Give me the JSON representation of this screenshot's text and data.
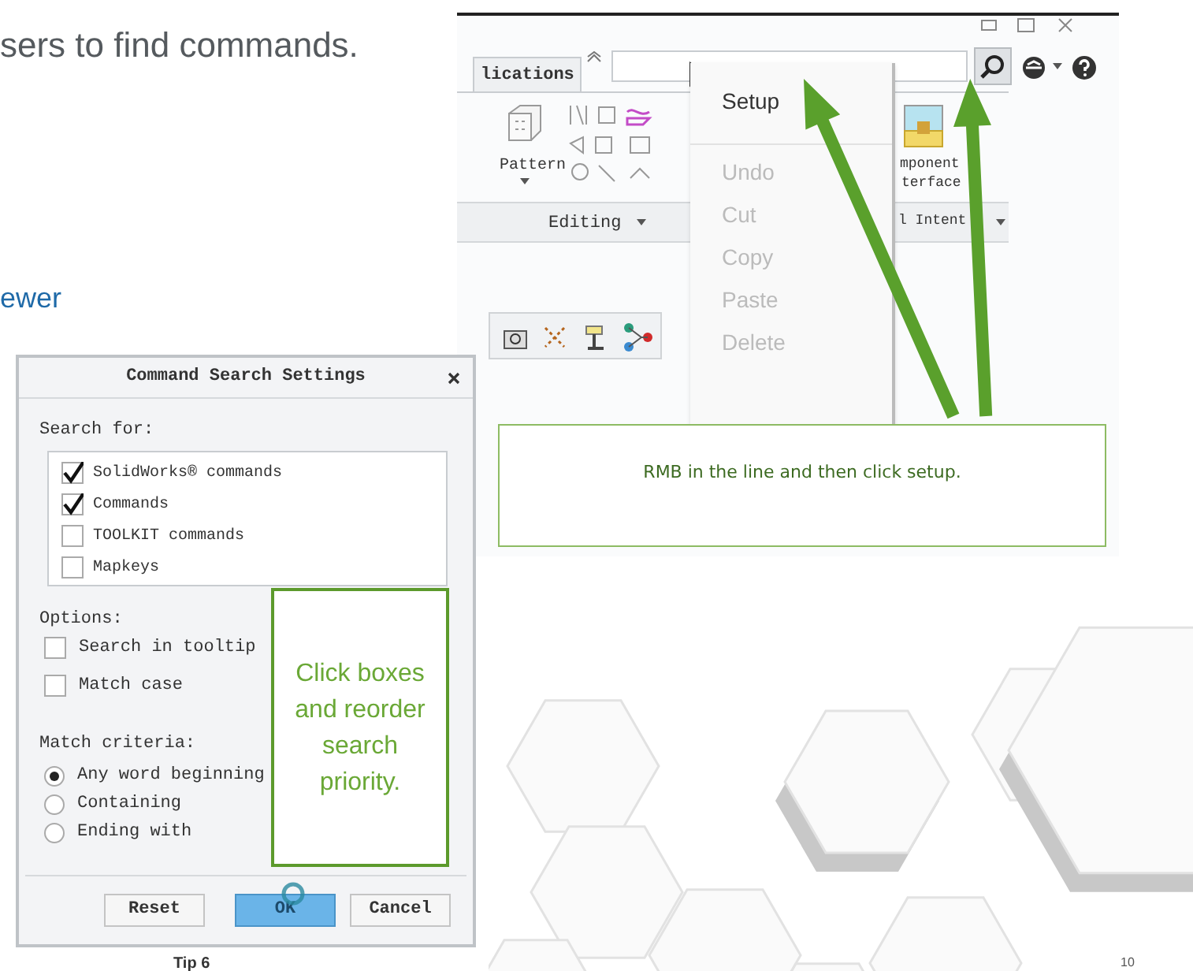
{
  "slide": {
    "heading": "sers to find commands.",
    "subheading": "ewer",
    "footer": "Tip 6",
    "page_number": "10"
  },
  "ribbon": {
    "tab": "lications",
    "pattern_label": "Pattern",
    "component_label": [
      "mponent",
      "terface"
    ],
    "group_labels": [
      "Editing",
      "l Intent"
    ]
  },
  "context_menu": [
    {
      "label": "Setup",
      "disabled": false
    },
    {
      "label": "Undo",
      "disabled": true
    },
    {
      "label": "Cut",
      "disabled": true
    },
    {
      "label": "Copy",
      "disabled": true
    },
    {
      "label": "Paste",
      "disabled": true
    },
    {
      "label": "Delete",
      "disabled": true
    }
  ],
  "note": "RMB in the line and then click setup.",
  "dialog": {
    "title": "Command Search Settings",
    "search_for_label": "Search for:",
    "search_for": [
      {
        "label": "SolidWorks® commands",
        "checked": true
      },
      {
        "label": "Commands",
        "checked": true
      },
      {
        "label": "TOOLKIT commands",
        "checked": false
      },
      {
        "label": "Mapkeys",
        "checked": false
      }
    ],
    "options_label": "Options:",
    "options": [
      {
        "label": "Search in tooltip",
        "checked": false
      },
      {
        "label": "Match case",
        "checked": false
      }
    ],
    "match_label": "Match criteria:",
    "match": [
      {
        "label": "Any word beginning",
        "selected": true
      },
      {
        "label": "Containing",
        "selected": false
      },
      {
        "label": "Ending with",
        "selected": false
      }
    ],
    "buttons": [
      {
        "label": "Reset",
        "kind": "default"
      },
      {
        "label": "OK",
        "kind": "primary"
      },
      {
        "label": "Cancel",
        "kind": "default"
      }
    ]
  },
  "callout": "Click boxes and reorder search priority."
}
